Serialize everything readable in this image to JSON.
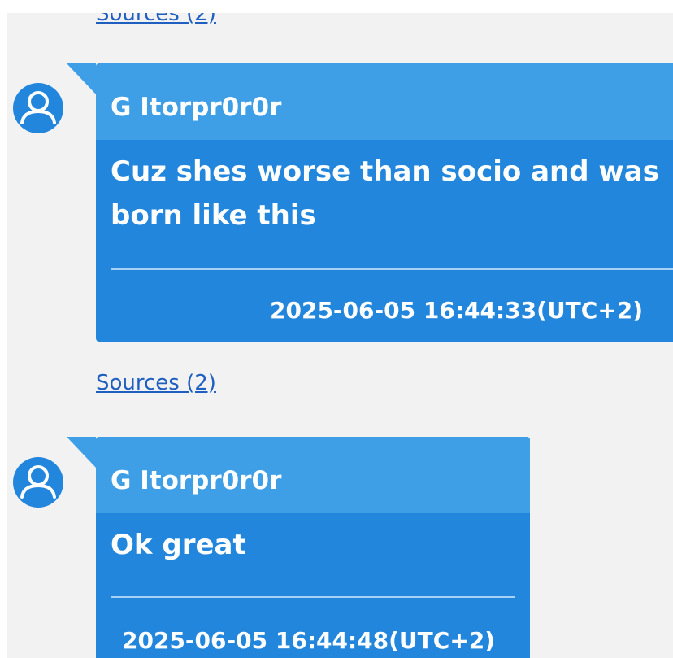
{
  "messages": [
    {
      "sender": "G Itorpr0r0r",
      "text": "Cuz shes worse than socio and was born like this",
      "timestamp": "2025-06-05 16:44:33(UTC+2)",
      "sources_label": "Sources (2)"
    },
    {
      "sender": "G Itorpr0r0r",
      "text": "Ok great",
      "timestamp": "2025-06-05 16:44:48(UTC+2)"
    }
  ],
  "top_sources_label": "Sources (2)",
  "icons": {
    "avatar": "user-avatar-icon"
  },
  "colors": {
    "bubble": "#2386dd",
    "bubble_header": "#3f9fe6",
    "link": "#1f5fc0",
    "background": "#f2f2f2"
  }
}
